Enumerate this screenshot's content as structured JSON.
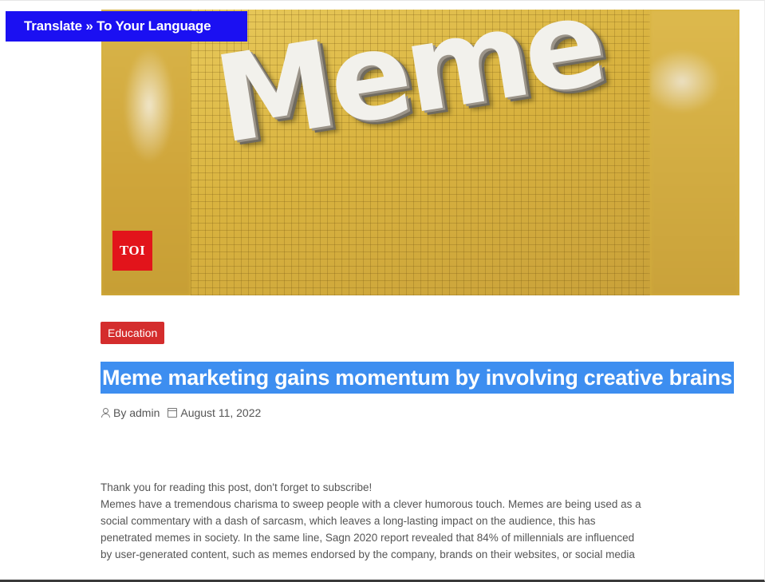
{
  "translate_bar": {
    "label": "Translate » To Your Language"
  },
  "hero_image": {
    "word": "Meme",
    "logo_text": "TOI",
    "colors": {
      "background": "#d7b23c",
      "logo_bg": "#e2141b"
    }
  },
  "post": {
    "category": "Education",
    "title": "Meme marketing gains momentum by involving creative brains",
    "author": "By admin",
    "date": "August 11, 2022",
    "intro": "Thank you for reading this post, don't forget to subscribe!",
    "body_lines": [
      "Memes have a tremendous charisma to sweep people with a clever humorous touch. Memes are being used as a",
      "social commentary with a dash of sarcasm, which leaves a long-lasting impact on the audience, this has",
      "penetrated memes in society. In the same line, Sagn 2020 report revealed that 84% of millennials are influenced",
      "by user-generated content, such as memes endorsed by the company, brands on their websites, or social media"
    ]
  },
  "icons": {
    "author": "user-icon",
    "date": "calendar-icon"
  },
  "colors": {
    "translate_bg": "#1b10f2",
    "category_bg": "#d42d2d",
    "title_highlight": "#3d8ef0"
  }
}
